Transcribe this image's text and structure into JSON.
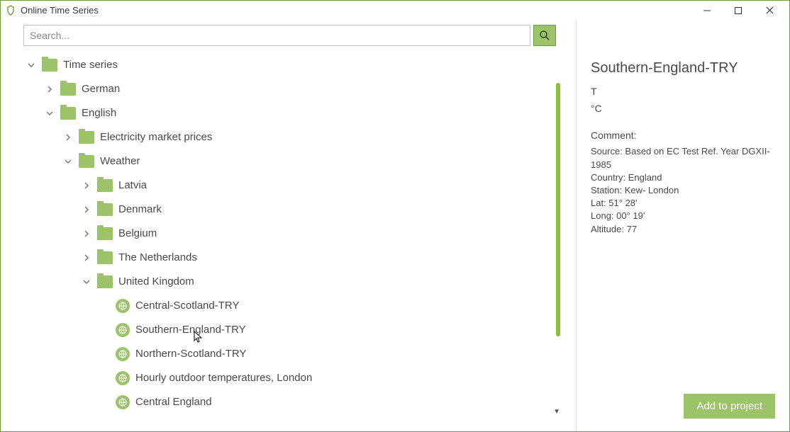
{
  "window": {
    "title": "Online Time Series"
  },
  "search": {
    "placeholder": "Search..."
  },
  "tree": {
    "root": {
      "label": "Time series",
      "expanded": true,
      "children": [
        {
          "label": "German",
          "type": "folder",
          "expanded": false
        },
        {
          "label": "English",
          "type": "folder",
          "expanded": true,
          "children": [
            {
              "label": "Electricity market prices",
              "type": "folder",
              "expanded": false
            },
            {
              "label": "Weather",
              "type": "folder",
              "expanded": true,
              "children": [
                {
                  "label": "Latvia",
                  "type": "folder",
                  "expanded": false
                },
                {
                  "label": "Denmark",
                  "type": "folder",
                  "expanded": false
                },
                {
                  "label": "Belgium",
                  "type": "folder",
                  "expanded": false
                },
                {
                  "label": "The Netherlands",
                  "type": "folder",
                  "expanded": false
                },
                {
                  "label": "United Kingdom",
                  "type": "folder",
                  "expanded": true,
                  "children": [
                    {
                      "label": "Central-Scotland-TRY",
                      "type": "data"
                    },
                    {
                      "label": "Southern-England-TRY",
                      "type": "data",
                      "selected": true
                    },
                    {
                      "label": "Northern-Scotland-TRY",
                      "type": "data"
                    },
                    {
                      "label": "Hourly outdoor temperatures, London",
                      "type": "data"
                    },
                    {
                      "label": "Central England",
                      "type": "data"
                    }
                  ]
                }
              ]
            }
          ]
        }
      ]
    }
  },
  "detail": {
    "title": "Southern-England-TRY",
    "quantity": "T",
    "unit": "°C",
    "comment_label": "Comment:",
    "comment": "Source: Based on EC Test Ref. Year DGXII-1985\nCountry: England\nStation: Kew- London\nLat: 51° 28'\nLong: 00° 19'\nAltitude: 77"
  },
  "buttons": {
    "add": "Add to project"
  }
}
